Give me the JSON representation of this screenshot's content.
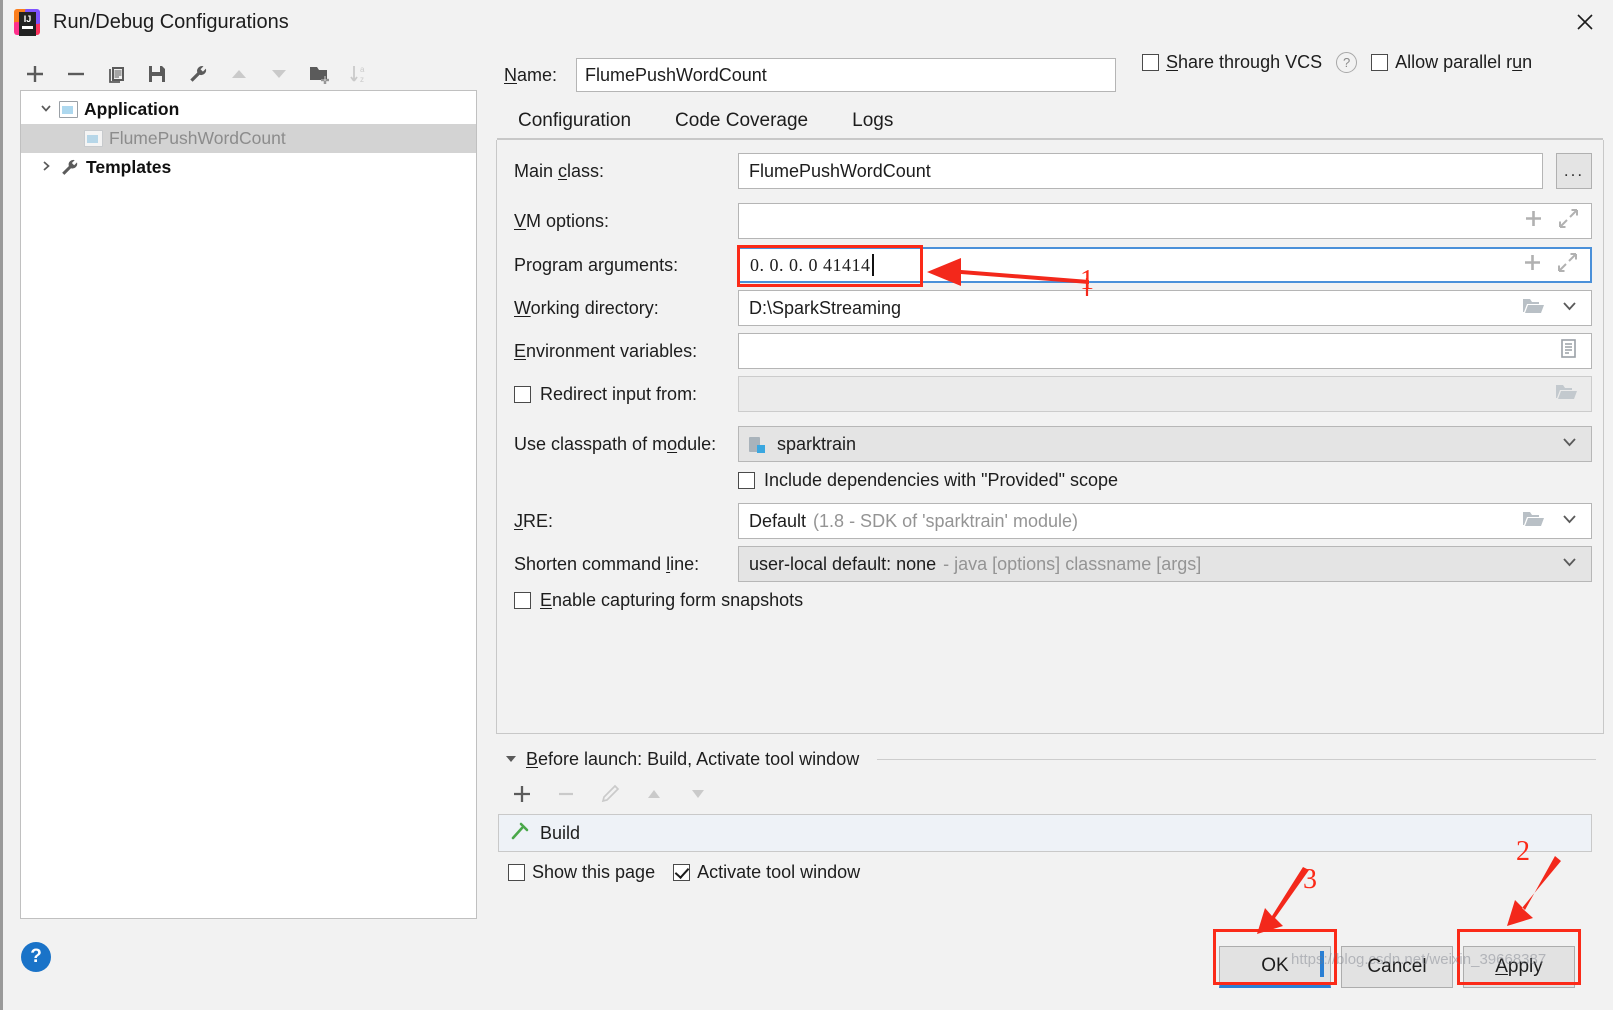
{
  "window": {
    "title": "Run/Debug Configurations",
    "app_icon": "intellij-idea-logo",
    "close_icon": "close-icon"
  },
  "sidebar": {
    "toolbar": [
      {
        "name": "add-configuration-button",
        "icon": "plus-icon",
        "glyph": "+",
        "enabled": true
      },
      {
        "name": "remove-configuration-button",
        "icon": "minus-icon",
        "glyph": "−",
        "enabled": true
      },
      {
        "name": "copy-configuration-button",
        "icon": "copy-icon",
        "glyph": "❐",
        "enabled": true
      },
      {
        "name": "save-configuration-button",
        "icon": "save-icon",
        "glyph": "ὋE",
        "enabled": true
      },
      {
        "name": "edit-templates-button",
        "icon": "wrench-icon",
        "glyph": "ὒ7",
        "enabled": true
      },
      {
        "name": "move-up-button",
        "icon": "arrow-up-icon",
        "glyph": "▲",
        "enabled": false
      },
      {
        "name": "move-down-button",
        "icon": "arrow-down-icon",
        "glyph": "▼",
        "enabled": false
      },
      {
        "name": "new-folder-button",
        "icon": "folder-add-icon",
        "glyph": "Ὄ1",
        "enabled": true
      },
      {
        "name": "sort-alphabetically-button",
        "icon": "sort-az-icon",
        "glyph": "↓az",
        "enabled": false
      }
    ],
    "tree": [
      {
        "label": "Application",
        "icon": "application-icon",
        "expanded": true,
        "bold": true,
        "level": 0,
        "selected": false
      },
      {
        "label": "FlumePushWordCount",
        "icon": "application-icon",
        "level": 1,
        "selected": true,
        "muted": true
      },
      {
        "label": "Templates",
        "icon": "wrench-icon",
        "expanded": false,
        "bold": true,
        "level": 0,
        "selected": false
      }
    ]
  },
  "header": {
    "name_label": "Name:",
    "name_value": "FlumePushWordCount",
    "share_vcs_label": "Share through VCS",
    "share_vcs_checked": false,
    "share_vcs_help_icon": "help-question-icon",
    "allow_parallel_label": "Allow parallel run",
    "allow_parallel_checked": false
  },
  "tabs": [
    {
      "label": "Configuration",
      "active": true
    },
    {
      "label": "Code Coverage",
      "active": false
    },
    {
      "label": "Logs",
      "active": false
    }
  ],
  "form": {
    "main_class": {
      "label": "Main class:",
      "value": "FlumePushWordCount",
      "browse_button_label": "...",
      "browse_icon": "ellipsis-icon"
    },
    "vm_options": {
      "label": "VM options:",
      "value": "",
      "icons": [
        "plus-icon",
        "expand-icon"
      ]
    },
    "program_arguments": {
      "label": "Program arguments:",
      "value": "0. 0. 0. 0  41414",
      "icons": [
        "plus-icon",
        "expand-icon"
      ],
      "focused": true,
      "highlight_color": "#fb2a18"
    },
    "working_directory": {
      "label": "Working directory:",
      "value": "D:\\SparkStreaming",
      "icons": [
        "folder-icon",
        "chevron-down-icon"
      ]
    },
    "environment_variables": {
      "label": "Environment variables:",
      "value": "",
      "icons": [
        "edit-list-icon"
      ]
    },
    "redirect_input": {
      "label": "Redirect input from:",
      "checked": false,
      "value": "",
      "disabled": true,
      "icons": [
        "folder-icon"
      ]
    },
    "use_classpath_of_module": {
      "label": "Use classpath of module:",
      "value": "sparktrain",
      "value_icon": "module-icon",
      "icons": [
        "chevron-down-icon"
      ]
    },
    "include_provided": {
      "label": "Include dependencies with \"Provided\" scope",
      "checked": false
    },
    "jre": {
      "label": "JRE:",
      "value": "Default",
      "value_hint": "(1.8 - SDK of 'sparktrain' module)",
      "icons": [
        "folder-icon",
        "chevron-down-icon"
      ]
    },
    "shorten_command_line": {
      "label": "Shorten command line:",
      "value": "user-local default: none",
      "value_hint": "- java [options] classname [args]",
      "icons": [
        "chevron-down-icon"
      ]
    },
    "enable_form_snapshots": {
      "label": "Enable capturing form snapshots",
      "checked": false
    }
  },
  "before_launch": {
    "header": "Before launch: Build, Activate tool window",
    "collapse_icon": "triangle-down-icon",
    "toolbar": [
      {
        "name": "add-task-button",
        "icon": "plus-icon",
        "glyph": "+",
        "enabled": true
      },
      {
        "name": "remove-task-button",
        "icon": "minus-icon",
        "glyph": "−",
        "enabled": false
      },
      {
        "name": "edit-task-button",
        "icon": "pencil-icon",
        "glyph": "✎",
        "enabled": false
      },
      {
        "name": "move-task-up-button",
        "icon": "arrow-up-icon",
        "glyph": "▲",
        "enabled": false
      },
      {
        "name": "move-task-down-button",
        "icon": "arrow-down-icon",
        "glyph": "▼",
        "enabled": false
      }
    ],
    "tasks": [
      {
        "label": "Build",
        "icon": "build-hammer-icon"
      }
    ],
    "show_this_page": {
      "label": "Show this page",
      "checked": false
    },
    "activate_tool_window": {
      "label": "Activate tool window",
      "checked": true
    }
  },
  "footer": {
    "help_icon": "help-question-icon",
    "ok_label": "OK",
    "cancel_label": "Cancel",
    "apply_label": "Apply"
  },
  "annotations": [
    {
      "number": "1",
      "target": "program-arguments-field"
    },
    {
      "number": "2",
      "target": "apply-button"
    },
    {
      "number": "3",
      "target": "ok-button"
    }
  ],
  "watermark": "https://blog.csdn.net/weixin_39668387"
}
